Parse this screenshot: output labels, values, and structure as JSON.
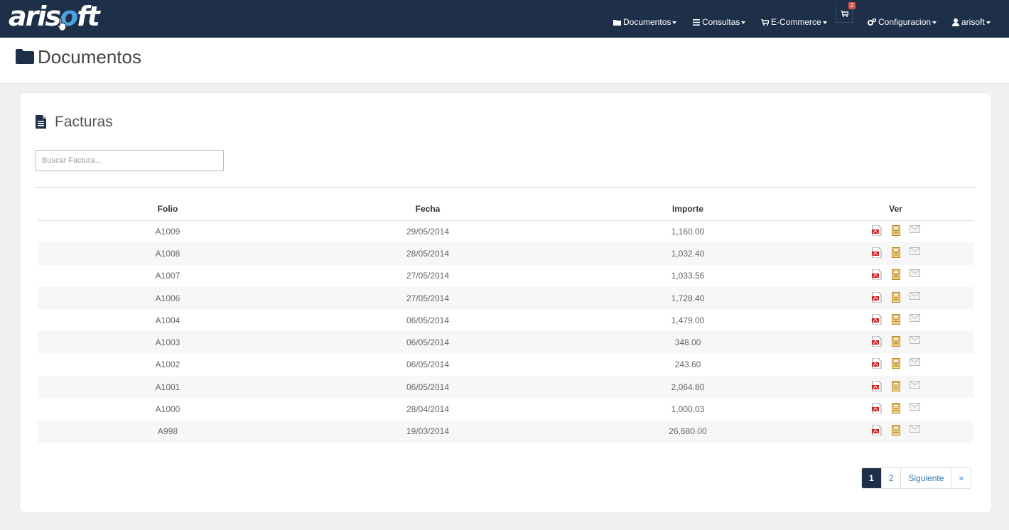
{
  "brand": {
    "logo_text_a": "aris",
    "logo_text_b": "o",
    "logo_text_c": "ft"
  },
  "nav": {
    "documentos": "Documentos",
    "consultas": "Consultas",
    "ecommerce": "E-Commerce",
    "cart_count": "2",
    "configuracion": "Configuracion",
    "user": "arisoft"
  },
  "header": {
    "title": "Documentos"
  },
  "card": {
    "title": "Facturas",
    "search_placeholder": "Buscar Factura..."
  },
  "table": {
    "columns": [
      "Folio",
      "Fecha",
      "Importe",
      "Ver"
    ],
    "rows": [
      {
        "folio": "A1009",
        "fecha": "29/05/2014",
        "importe": "1,160.00"
      },
      {
        "folio": "A1008",
        "fecha": "28/05/2014",
        "importe": "1,032.40"
      },
      {
        "folio": "A1007",
        "fecha": "27/05/2014",
        "importe": "1,033.56"
      },
      {
        "folio": "A1006",
        "fecha": "27/05/2014",
        "importe": "1,728.40"
      },
      {
        "folio": "A1004",
        "fecha": "06/05/2014",
        "importe": "1,479.00"
      },
      {
        "folio": "A1003",
        "fecha": "06/05/2014",
        "importe": "348.00"
      },
      {
        "folio": "A1002",
        "fecha": "06/05/2014",
        "importe": "243.60"
      },
      {
        "folio": "A1001",
        "fecha": "06/05/2014",
        "importe": "2,064.80"
      },
      {
        "folio": "A1000",
        "fecha": "28/04/2014",
        "importe": "1,000.03"
      },
      {
        "folio": "A998",
        "fecha": "19/03/2014",
        "importe": "26,680.00"
      }
    ],
    "row_icons": [
      "pdf-icon",
      "xml-icon",
      "email-icon"
    ]
  },
  "pagination": {
    "pages": [
      "1",
      "2"
    ],
    "active": "1",
    "next_label": "Siguiente",
    "last_label": "»"
  },
  "colors": {
    "navbar": "#1e3049",
    "badge": "#d9534f",
    "pdf": "#cc2222",
    "xml": "#d9a24a"
  }
}
